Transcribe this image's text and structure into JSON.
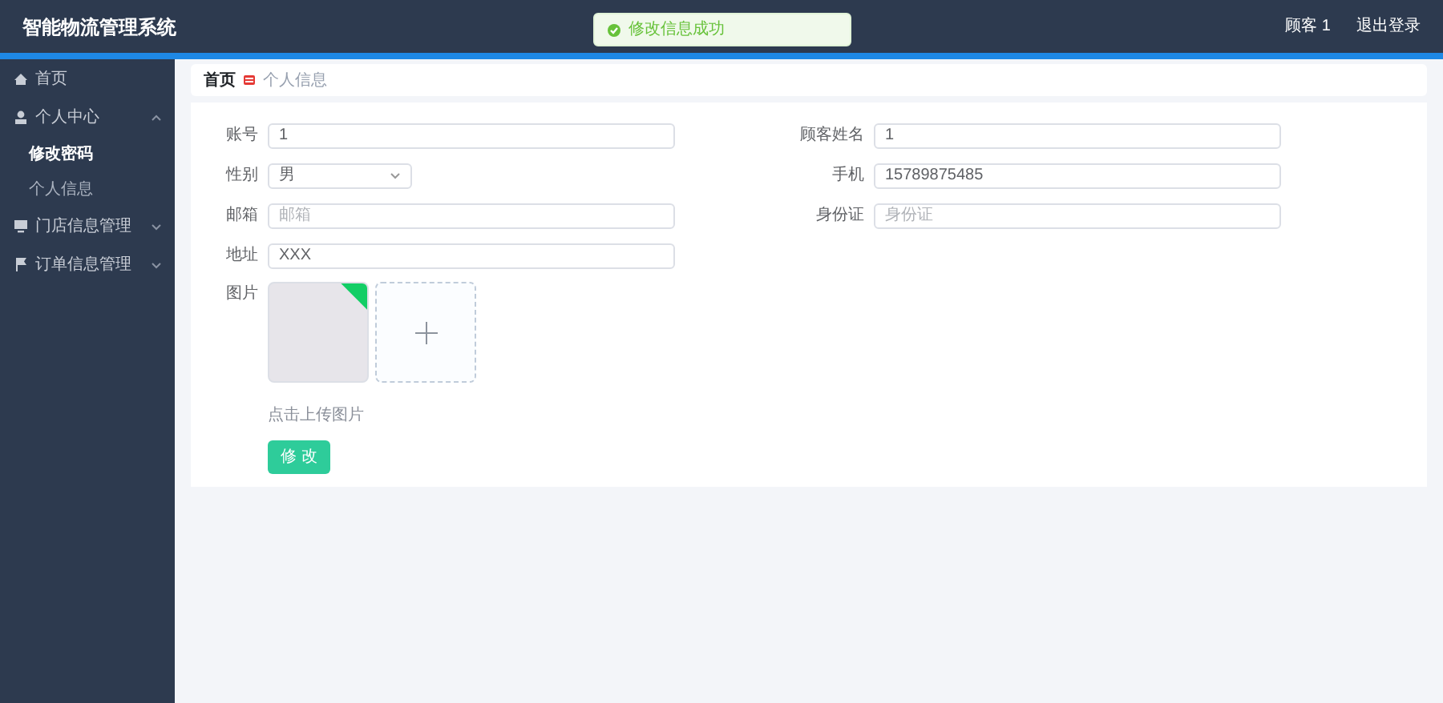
{
  "header": {
    "title": "智能物流管理系统",
    "user": "顾客 1",
    "logout": "退出登录"
  },
  "toast": {
    "message": "修改信息成功"
  },
  "sidebar": {
    "items": [
      {
        "label": "首页"
      },
      {
        "label": "个人中心",
        "expanded": true,
        "children": [
          {
            "label": "修改密码",
            "selected": true
          },
          {
            "label": "个人信息",
            "selected": false
          }
        ]
      },
      {
        "label": "门店信息管理",
        "expanded": false
      },
      {
        "label": "订单信息管理",
        "expanded": false
      }
    ]
  },
  "breadcrumb": [
    "首页",
    "个人信息"
  ],
  "form": {
    "fields": [
      {
        "label": "账号",
        "kind": "text",
        "value": "1"
      },
      {
        "label": "顾客姓名",
        "kind": "text",
        "value": "1"
      },
      {
        "label": "性别",
        "kind": "select",
        "value": "男"
      },
      {
        "label": "手机",
        "kind": "text",
        "value": "15789875485"
      },
      {
        "label": "邮箱",
        "kind": "text",
        "placeholder": "邮箱"
      },
      {
        "label": "身份证",
        "kind": "text",
        "placeholder": "身份证"
      },
      {
        "label": "地址",
        "kind": "text",
        "value": "XXX"
      }
    ],
    "image": {
      "label": "图片",
      "uploaded": true,
      "hint": "点击上传图片"
    },
    "submit": "修 改"
  }
}
